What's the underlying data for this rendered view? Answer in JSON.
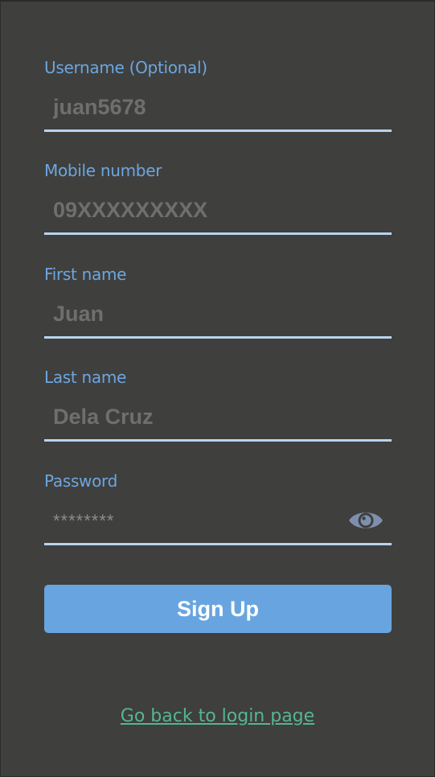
{
  "form": {
    "fields": [
      {
        "label": "Username (Optional)",
        "placeholder": "juan5678",
        "value": ""
      },
      {
        "label": "Mobile number",
        "placeholder": "09XXXXXXXXX",
        "value": ""
      },
      {
        "label": "First name",
        "placeholder": "Juan",
        "value": ""
      },
      {
        "label": "Last name",
        "placeholder": "Dela Cruz",
        "value": ""
      },
      {
        "label": "Password",
        "placeholder": "********",
        "value": "",
        "toggle_icon": "eye-icon"
      }
    ],
    "submit_label": "Sign Up",
    "back_link_label": "Go back to login page"
  },
  "colors": {
    "background": "#3f3f3d",
    "label": "#6ca6e0",
    "placeholder": "#6f6f6d",
    "underline": "#b9d3ee",
    "button": "#68a5e0",
    "button_text": "#ffffff",
    "link": "#55b592",
    "eye_icon": "#7e8fae"
  }
}
